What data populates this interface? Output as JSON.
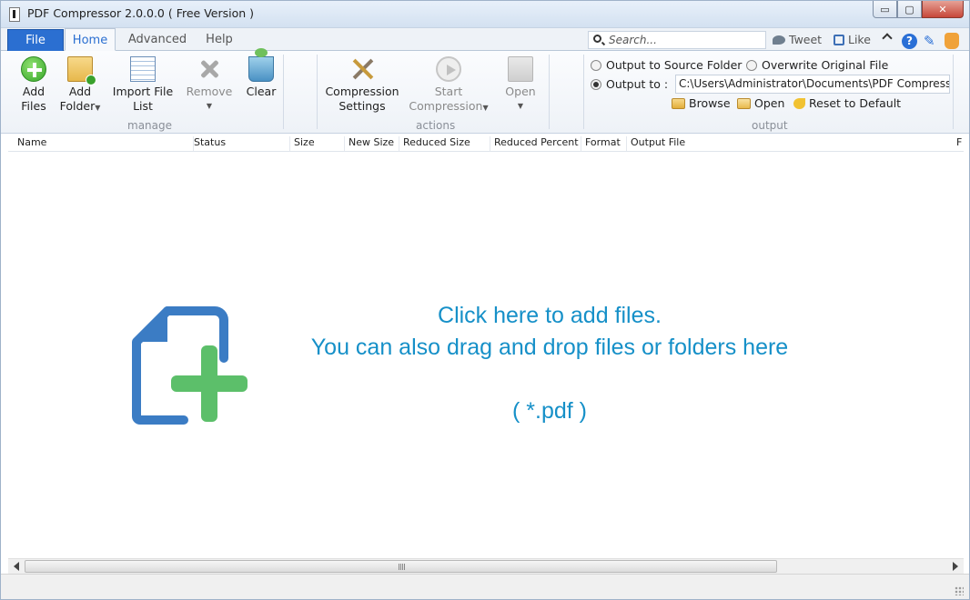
{
  "window": {
    "title": "PDF Compressor 2.0.0.0 ( Free Version )",
    "buttons": {
      "minimize": "▭",
      "maximize": "▢",
      "close": "✕"
    }
  },
  "tabs": {
    "file": "File",
    "home": "Home",
    "advanced": "Advanced",
    "help": "Help"
  },
  "top_right": {
    "search_placeholder": "Search...",
    "tweet": "Tweet",
    "like": "Like"
  },
  "manage": {
    "add_files": [
      "Add",
      "Files"
    ],
    "add_folder": [
      "Add",
      "Folder"
    ],
    "import_list": [
      "Import File",
      "List"
    ],
    "remove": "Remove",
    "clear": "Clear",
    "group_label": "manage"
  },
  "actions": {
    "compression_settings": [
      "Compression",
      "Settings"
    ],
    "start_compression": [
      "Start",
      "Compression"
    ],
    "open": "Open",
    "group_label": "actions"
  },
  "output": {
    "source_folder": "Output to Source Folder",
    "overwrite": "Overwrite Original File",
    "output_to": "Output to :",
    "path": "C:\\Users\\Administrator\\Documents\\PDF Compressor",
    "browse": "Browse",
    "open": "Open",
    "reset": "Reset to Default",
    "group_label": "output",
    "selected": "output_to"
  },
  "columns": [
    "Name",
    "Status",
    "Size",
    "New Size",
    "Reduced Size",
    "Reduced Percent",
    "Format",
    "Output File",
    "F"
  ],
  "drop": {
    "line1": "Click here to add files.",
    "line2": "You can also drag and drop files or folders here",
    "line3": "( *.pdf )"
  },
  "colors": {
    "accent": "#2b6fd1",
    "drop_text": "#1690c8",
    "doc_blue": "#3b7cc4",
    "plus_green": "#5cbf6a"
  },
  "icons": [
    "add-files-icon",
    "add-folder-icon",
    "import-list-icon",
    "remove-icon",
    "clear-icon",
    "compression-settings-icon",
    "start-compression-icon",
    "open-icon",
    "search-icon",
    "twitter-icon",
    "like-icon",
    "help-icon",
    "pin-icon",
    "hand-icon",
    "add-document-icon"
  ]
}
